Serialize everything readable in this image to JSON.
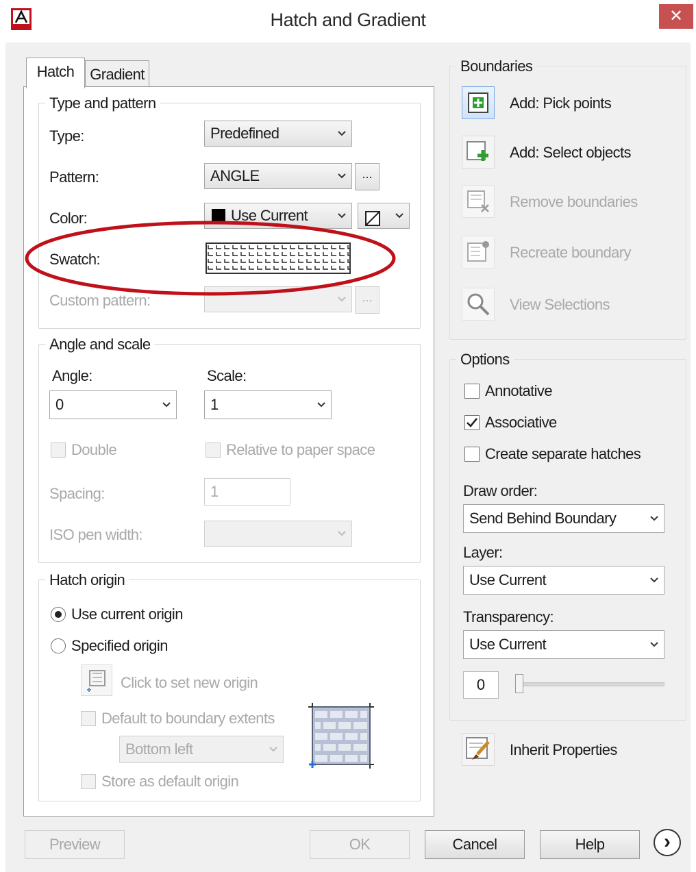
{
  "window": {
    "title": "Hatch and Gradient",
    "close_glyph": "✕"
  },
  "tabs": [
    {
      "label": "Hatch"
    },
    {
      "label": "Gradient"
    }
  ],
  "type_and_pattern": {
    "title": "Type and pattern",
    "type_label": "Type:",
    "type_value": "Predefined",
    "pattern_label": "Pattern:",
    "pattern_value": "ANGLE",
    "pattern_browse": "...",
    "color_label": "Color:",
    "color_value": "Use Current",
    "swatch_label": "Swatch:",
    "custom_pattern_label": "Custom pattern:",
    "custom_browse": "..."
  },
  "angle_and_scale": {
    "title": "Angle and scale",
    "angle_label": "Angle:",
    "angle_value": "0",
    "scale_label": "Scale:",
    "scale_value": "1",
    "double_label": "Double",
    "relative_label": "Relative to paper space",
    "spacing_label": "Spacing:",
    "spacing_value": "1",
    "iso_label": "ISO pen width:"
  },
  "hatch_origin": {
    "title": "Hatch origin",
    "use_current_label": "Use current origin",
    "specified_label": "Specified origin",
    "click_set_label": "Click to set new origin",
    "default_extents_label": "Default to boundary extents",
    "position_value": "Bottom left",
    "store_default_label": "Store as default origin"
  },
  "boundaries": {
    "title": "Boundaries",
    "add_pick": "Add: Pick points",
    "add_select": "Add: Select objects",
    "remove": "Remove boundaries",
    "recreate": "Recreate boundary",
    "view": "View Selections"
  },
  "options": {
    "title": "Options",
    "annotative": "Annotative",
    "associative": "Associative",
    "separate": "Create separate hatches",
    "draw_order_label": "Draw order:",
    "draw_order_value": "Send Behind Boundary",
    "layer_label": "Layer:",
    "layer_value": "Use Current",
    "transparency_label": "Transparency:",
    "transparency_value": "Use Current",
    "transparency_amount": "0"
  },
  "inherit_label": "Inherit Properties",
  "footer": {
    "preview": "Preview",
    "ok": "OK",
    "cancel": "Cancel",
    "help": "Help",
    "more_glyph": "›"
  },
  "colors": {
    "accent_red": "#c0101a",
    "close_red": "#c75050",
    "green_plus": "#2ea02e"
  },
  "annotation": {
    "highlight": "red ellipse around Swatch row"
  }
}
